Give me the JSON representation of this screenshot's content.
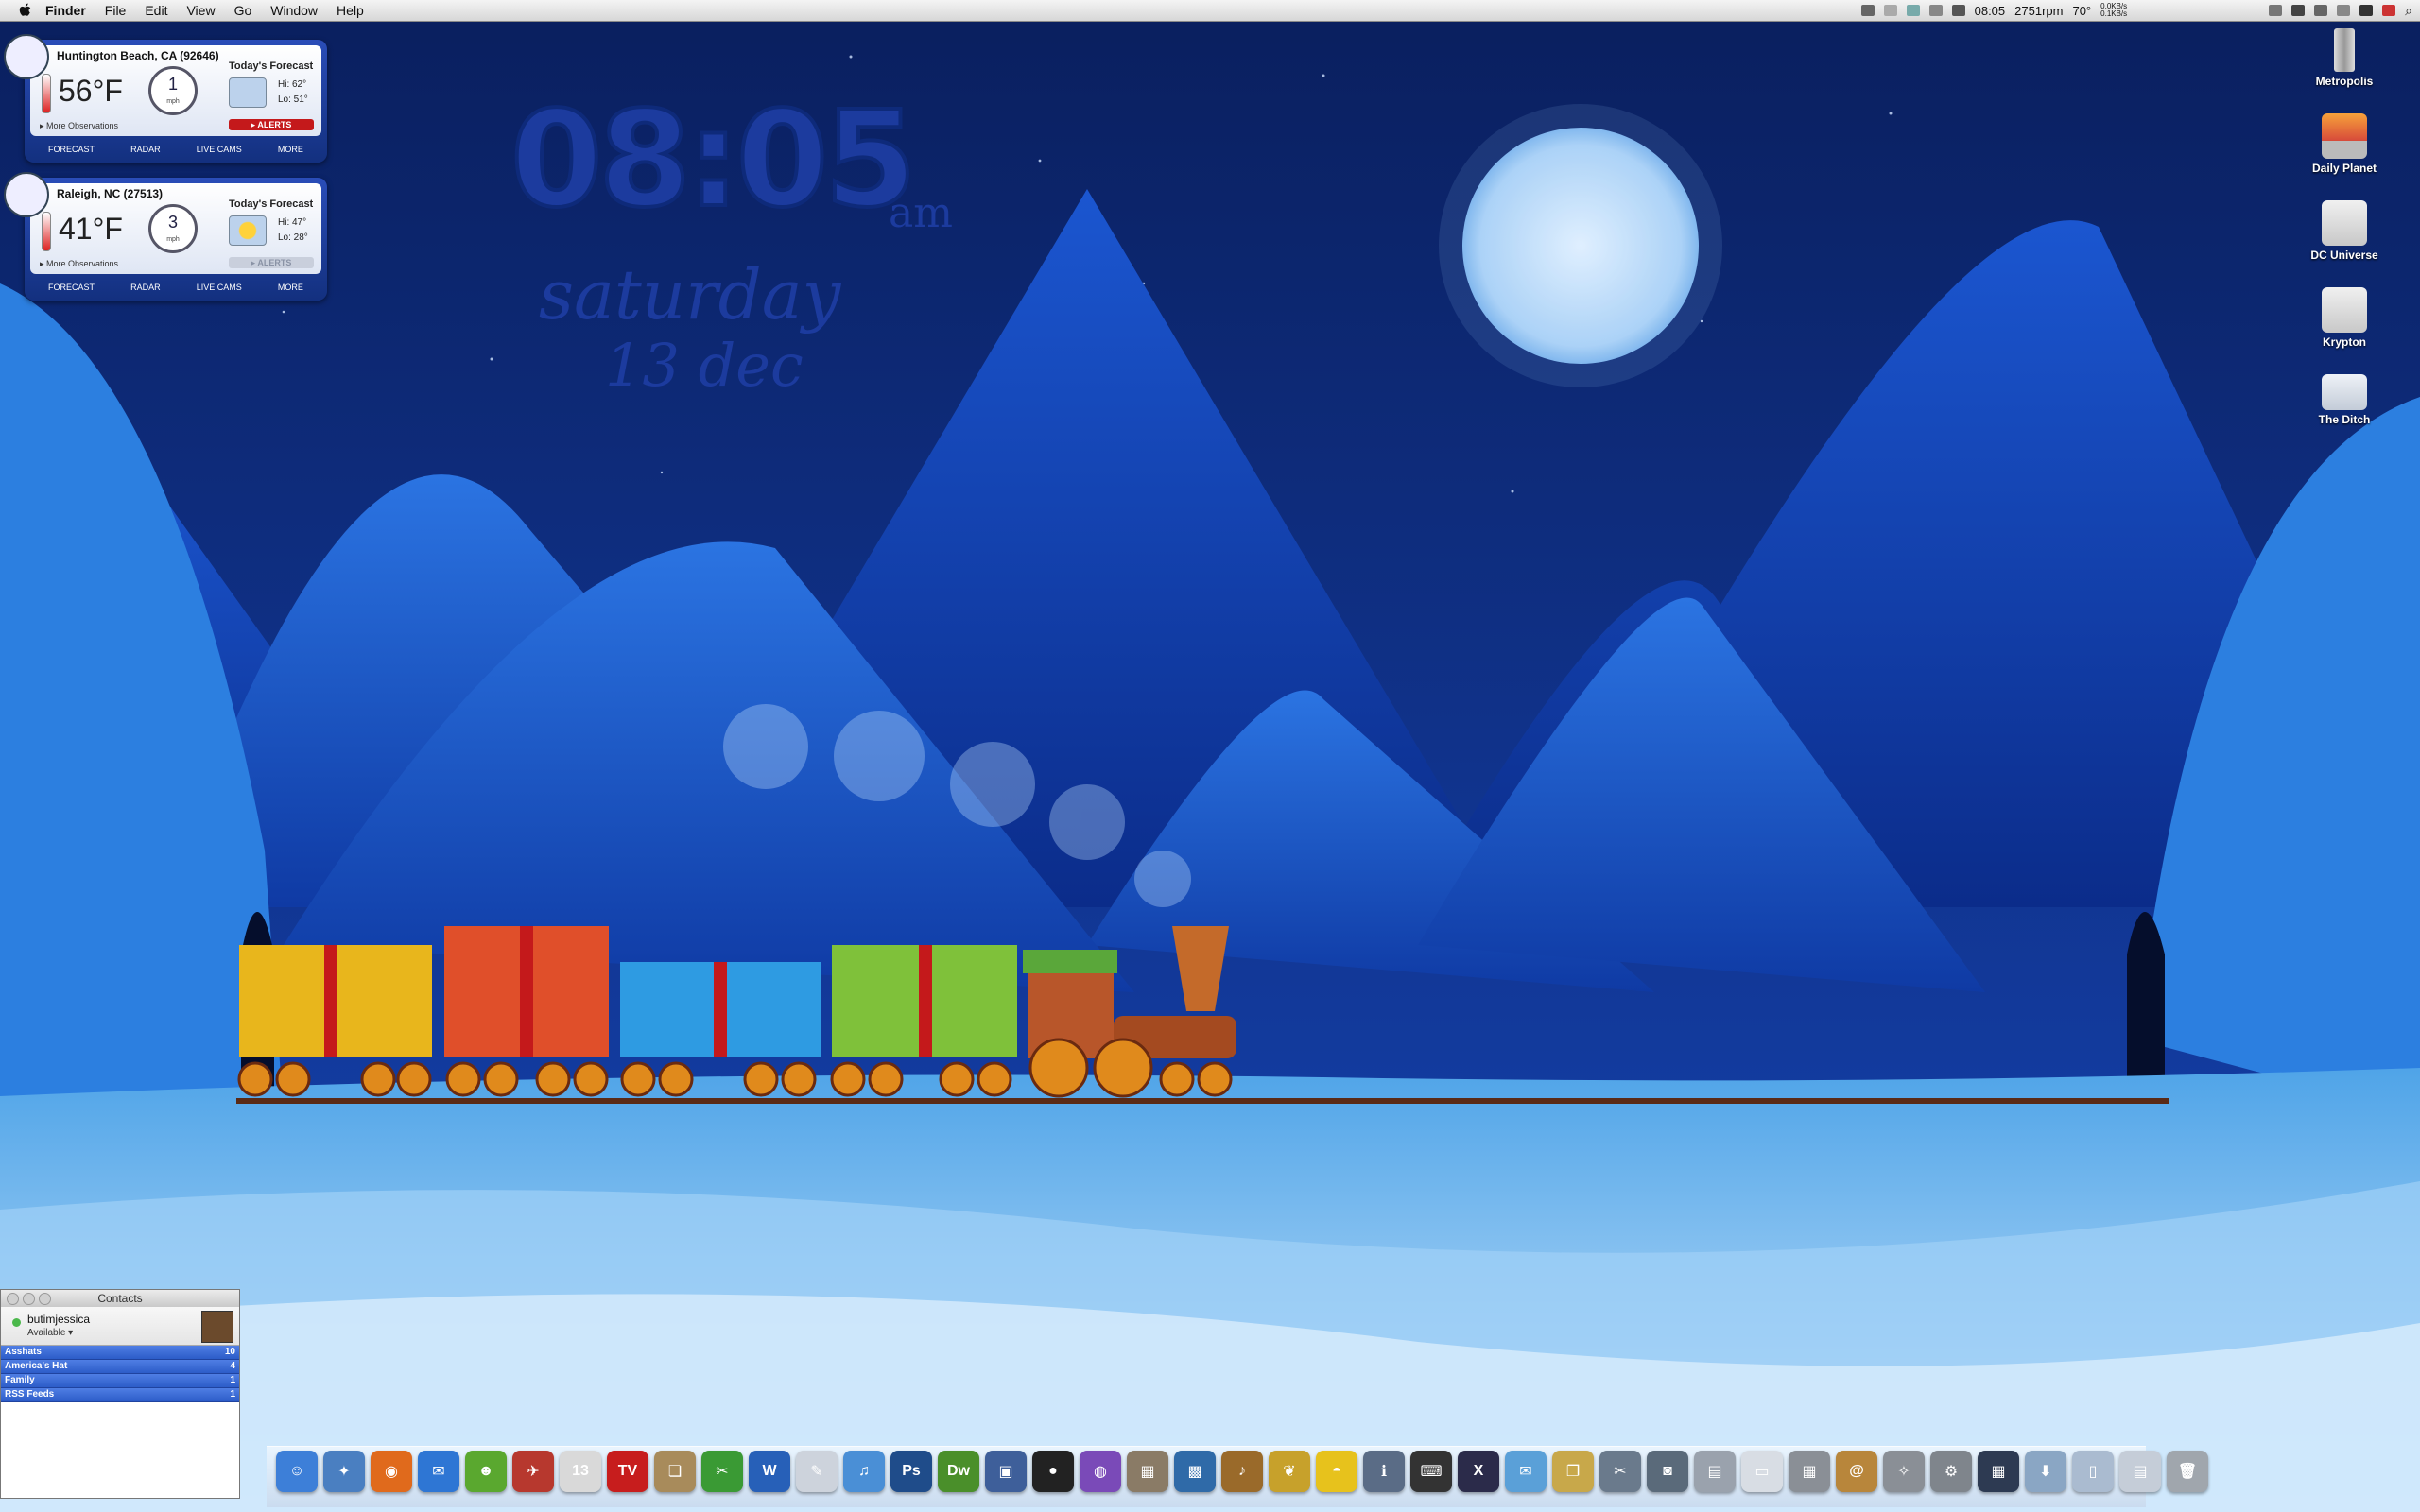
{
  "menubar": {
    "apple": "",
    "menus": [
      "Finder",
      "File",
      "Edit",
      "View",
      "Go",
      "Window",
      "Help"
    ],
    "status": {
      "clock": "08:05",
      "fan": "2751rpm",
      "temp": "70°",
      "net_up": "0.0KB/s",
      "net_down": "0.1KB/s"
    }
  },
  "weather": [
    {
      "location": "Huntington Beach, CA (92646)",
      "temp": "56°F",
      "wind_speed": "1",
      "wind_unit": "mph",
      "forecast_title": "Today's Forecast",
      "hi": "Hi: 62°",
      "lo": "Lo: 51°",
      "alerts": "▸ ALERTS",
      "alerts_color": "#c4191b",
      "more_obs": "▸ More Observations",
      "tabs": [
        "FORECAST",
        "RADAR",
        "LIVE CAMS",
        "MORE"
      ]
    },
    {
      "location": "Raleigh, NC (27513)",
      "temp": "41°F",
      "wind_speed": "3",
      "wind_unit": "mph",
      "forecast_title": "Today's Forecast",
      "hi": "Hi: 47°",
      "lo": "Lo: 28°",
      "alerts": "▸ ALERTS",
      "alerts_color": "#c9cfdc",
      "more_obs": "▸ More Observations",
      "tabs": [
        "FORECAST",
        "RADAR",
        "LIVE CAMS",
        "MORE"
      ]
    }
  ],
  "clock": {
    "time": "08:05",
    "ampm": "am",
    "day": "saturday",
    "date": "13 dec"
  },
  "desktop_icons": [
    {
      "label": "Metropolis",
      "icon": "drive-icon"
    },
    {
      "label": "Daily Planet",
      "icon": "apple-drive-icon"
    },
    {
      "label": "DC Universe",
      "icon": "time-machine-drive-icon"
    },
    {
      "label": "Krypton",
      "icon": "external-drive-icon"
    },
    {
      "label": "The Ditch",
      "icon": "folder-icon"
    }
  ],
  "contacts": {
    "title": "Contacts",
    "user": "butimjessica",
    "status": "Available ▾",
    "groups": [
      {
        "name": "Asshats",
        "count": "10"
      },
      {
        "name": "America's Hat",
        "count": "4"
      },
      {
        "name": "Family",
        "count": "1"
      },
      {
        "name": "RSS Feeds",
        "count": "1"
      }
    ]
  },
  "dock": {
    "items": [
      {
        "name": "finder",
        "glyph": "☺",
        "color": "#3d7fd8"
      },
      {
        "name": "safari",
        "glyph": "✦",
        "color": "#4a7fc1"
      },
      {
        "name": "firefox",
        "glyph": "◉",
        "color": "#e06a1c"
      },
      {
        "name": "ichat",
        "glyph": "✉",
        "color": "#2e76d4"
      },
      {
        "name": "adium",
        "glyph": "☻",
        "color": "#5aa82f"
      },
      {
        "name": "mail-stamp",
        "glyph": "✈",
        "color": "#b7382e"
      },
      {
        "name": "ical",
        "glyph": "13",
        "color": "#d9d9d9"
      },
      {
        "name": "tv",
        "glyph": "TV",
        "color": "#c71d1d"
      },
      {
        "name": "preview",
        "glyph": "❏",
        "color": "#a88b5b"
      },
      {
        "name": "xcode-tool",
        "glyph": "✂",
        "color": "#3a9a34"
      },
      {
        "name": "word",
        "glyph": "W",
        "color": "#2760b8"
      },
      {
        "name": "textedit",
        "glyph": "✎",
        "color": "#cdd3dc"
      },
      {
        "name": "itunes",
        "glyph": "♫",
        "color": "#4a8fd6"
      },
      {
        "name": "photoshop",
        "glyph": "Ps",
        "color": "#1f4c8a"
      },
      {
        "name": "dreamweaver",
        "glyph": "Dw",
        "color": "#4a8f2a"
      },
      {
        "name": "remote-desktop",
        "glyph": "▣",
        "color": "#3e5f9a"
      },
      {
        "name": "front-row",
        "glyph": "●",
        "color": "#222222"
      },
      {
        "name": "color-picker",
        "glyph": "◍",
        "color": "#7a4ab8"
      },
      {
        "name": "calculator-tool",
        "glyph": "▦",
        "color": "#8a7b66"
      },
      {
        "name": "iphoto",
        "glyph": "▩",
        "color": "#2f6aa8"
      },
      {
        "name": "garageband",
        "glyph": "♪",
        "color": "#9a6a2a"
      },
      {
        "name": "pineapple",
        "glyph": "❦",
        "color": "#c7a12b"
      },
      {
        "name": "cyberduck",
        "glyph": "◓",
        "color": "#e7c21c"
      },
      {
        "name": "system-info",
        "glyph": "ℹ",
        "color": "#5a6c86"
      },
      {
        "name": "terminal",
        "glyph": "⌨",
        "color": "#333333"
      },
      {
        "name": "osx",
        "glyph": "X",
        "color": "#2b2b4a"
      },
      {
        "name": "transmit",
        "glyph": "✉",
        "color": "#5aa0d8"
      },
      {
        "name": "stickies",
        "glyph": "❐",
        "color": "#c8a84a"
      },
      {
        "name": "screenshot",
        "glyph": "✂",
        "color": "#6a7a8c"
      },
      {
        "name": "capture",
        "glyph": "◙",
        "color": "#5a6a7a"
      },
      {
        "name": "photo-booth",
        "glyph": "▤",
        "color": "#9aa2ad"
      },
      {
        "name": "pages",
        "glyph": "▭",
        "color": "#d8dde4"
      },
      {
        "name": "calculator",
        "glyph": "▦",
        "color": "#8a8f96"
      },
      {
        "name": "address-book",
        "glyph": "@",
        "color": "#b8863b"
      },
      {
        "name": "utilities",
        "glyph": "✧",
        "color": "#8a8f96"
      },
      {
        "name": "system-preferences",
        "glyph": "⚙",
        "color": "#7f858c"
      },
      {
        "name": "dashboard",
        "glyph": "▦",
        "color": "#2d3a52"
      },
      {
        "name": "downloads-stack",
        "glyph": "⬇",
        "color": "#8aa6c4"
      },
      {
        "name": "documents-stack",
        "glyph": "▯",
        "color": "#aabbd0"
      },
      {
        "name": "applications-stack",
        "glyph": "▤",
        "color": "#c5cdd8"
      },
      {
        "name": "trash",
        "glyph": "🗑",
        "color": "#a0a6ad"
      }
    ]
  }
}
